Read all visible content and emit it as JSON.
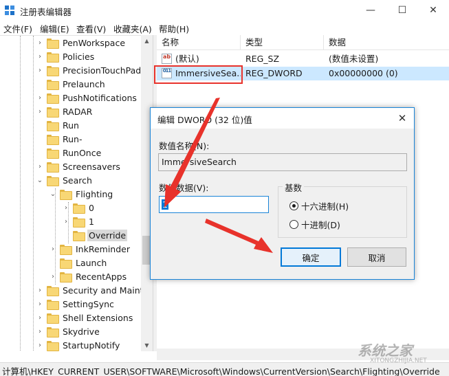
{
  "window": {
    "title": "注册表编辑器",
    "min_glyph": "—",
    "max_glyph": "☐",
    "close_glyph": "✕"
  },
  "menu": [
    "文件(F)",
    "编辑(E)",
    "查看(V)",
    "收藏夹(A)",
    "帮助(H)"
  ],
  "tree": {
    "items": [
      {
        "label": "PenWorkspace",
        "arrow": "›"
      },
      {
        "label": "Policies",
        "arrow": "›"
      },
      {
        "label": "PrecisionTouchPad",
        "arrow": "›"
      },
      {
        "label": "Prelaunch",
        "arrow": ""
      },
      {
        "label": "PushNotifications",
        "arrow": "›"
      },
      {
        "label": "RADAR",
        "arrow": "›"
      },
      {
        "label": "Run",
        "arrow": ""
      },
      {
        "label": "Run-",
        "arrow": ""
      },
      {
        "label": "RunOnce",
        "arrow": ""
      },
      {
        "label": "Screensavers",
        "arrow": "›"
      },
      {
        "label": "Search",
        "arrow": "⌄"
      },
      {
        "label": "Flighting",
        "arrow": "⌄"
      },
      {
        "label": "0",
        "arrow": "›"
      },
      {
        "label": "1",
        "arrow": "›"
      },
      {
        "label": "Override",
        "arrow": ""
      },
      {
        "label": "InkReminder",
        "arrow": "›"
      },
      {
        "label": "Launch",
        "arrow": ""
      },
      {
        "label": "RecentApps",
        "arrow": "›"
      },
      {
        "label": "Security and Mainte",
        "arrow": "›"
      },
      {
        "label": "SettingSync",
        "arrow": "›"
      },
      {
        "label": "Shell Extensions",
        "arrow": "›"
      },
      {
        "label": "Skydrive",
        "arrow": "›"
      },
      {
        "label": "StartupNotify",
        "arrow": "›"
      }
    ]
  },
  "list": {
    "headers": [
      "名称",
      "类型",
      "数据"
    ],
    "rows": [
      {
        "name": "(默认)",
        "type": "REG_SZ",
        "data": "(数值未设置)",
        "icon": "ab"
      },
      {
        "name": "ImmersiveSea...",
        "type": "REG_DWORD",
        "data": "0x00000000 (0)",
        "icon": "011"
      }
    ]
  },
  "status_path": "计算机\\HKEY_CURRENT_USER\\SOFTWARE\\Microsoft\\Windows\\CurrentVersion\\Search\\Flighting\\Override",
  "dialog": {
    "title": "编辑 DWORD (32 位)值",
    "name_label": "数值名称(N):",
    "name_value": "ImmersiveSearch",
    "data_label": "数值数据(V):",
    "data_value": "1",
    "base_label": "基数",
    "radio_hex": "十六进制(H)",
    "radio_dec": "十进制(D)",
    "base_selected": "hex",
    "ok": "确定",
    "cancel": "取消"
  },
  "watermark": {
    "text": "系统之家",
    "sub": "XITONGZHIJIA.NET"
  },
  "colors": {
    "accent": "#0078d7",
    "highlight_red": "#e8322b",
    "selection": "#cce8ff",
    "folder": "#f8d775"
  }
}
